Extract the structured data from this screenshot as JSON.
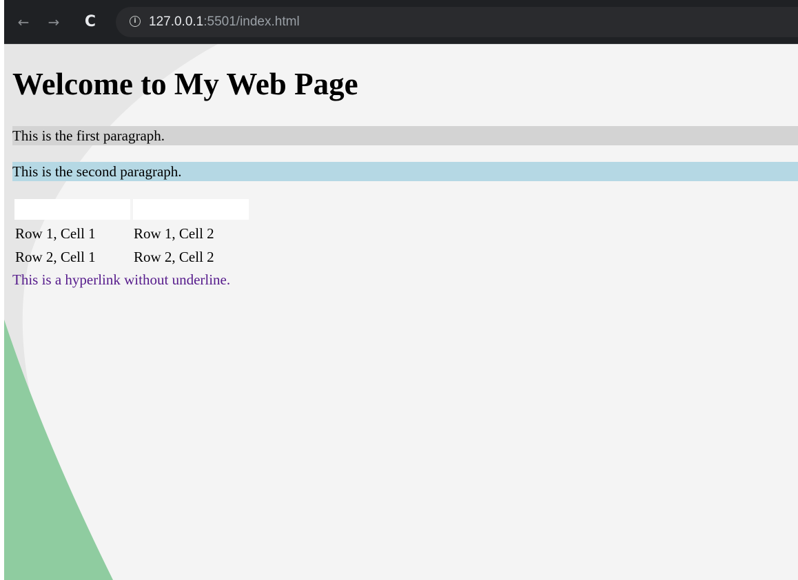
{
  "browser": {
    "back_icon": "←",
    "forward_icon": "→",
    "reload_icon": "C",
    "info_icon": "i",
    "url_host": "127.0.0.1",
    "url_rest": ":5501/index.html"
  },
  "page": {
    "heading": "Welcome to My Web Page",
    "paragraphs": [
      "This is the first paragraph.",
      "This is the second paragraph."
    ],
    "table": {
      "header": [
        "",
        ""
      ],
      "rows": [
        [
          "Row 1, Cell 1",
          "Row 1, Cell 2"
        ],
        [
          "Row 2, Cell 1",
          "Row 2, Cell 2"
        ]
      ]
    },
    "link_text": "This is a hyperlink without underline."
  },
  "colors": {
    "toolbar": "#1f2124",
    "page_background": "#f4f4f4",
    "paragraph_1_background": "#d3d3d3",
    "paragraph_2_background": "#b5d8e4",
    "link": "#551a8b",
    "background_art_green": "#8fcca0"
  }
}
